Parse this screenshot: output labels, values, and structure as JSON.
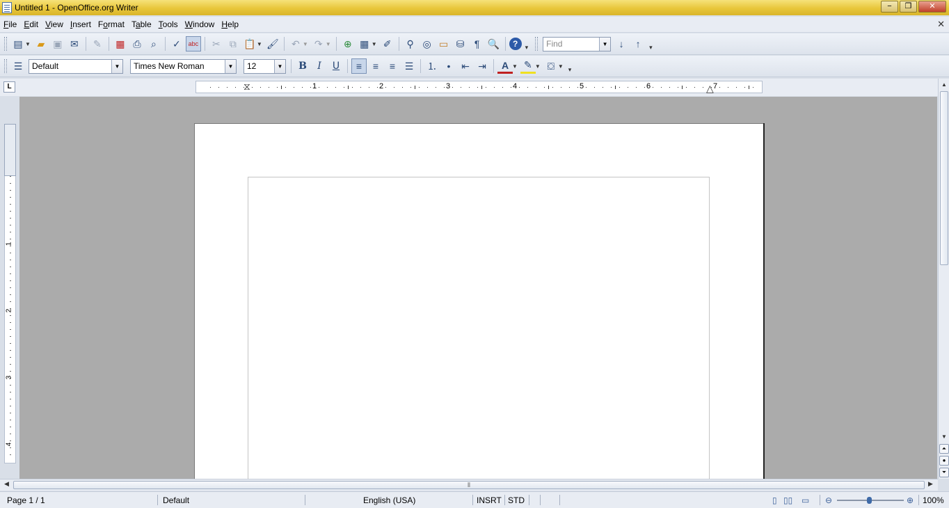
{
  "window": {
    "title": "Untitled 1 - OpenOffice.org Writer",
    "minimize_symbol": "−",
    "restore_symbol": "❐",
    "close_symbol": "✕"
  },
  "menubar": {
    "items": [
      {
        "accel": "F",
        "rest": "ile"
      },
      {
        "accel": "E",
        "rest": "dit"
      },
      {
        "accel": "V",
        "rest": "iew"
      },
      {
        "accel": "I",
        "rest": "nsert"
      },
      {
        "pre": "F",
        "accel": "o",
        "rest": "rmat"
      },
      {
        "pre": "T",
        "accel": "a",
        "rest": "ble"
      },
      {
        "accel": "T",
        "rest": "ools"
      },
      {
        "accel": "W",
        "rest": "indow"
      },
      {
        "accel": "H",
        "rest": "elp"
      }
    ],
    "doc_close_symbol": "✕"
  },
  "standard_toolbar": {
    "find_placeholder": "Find"
  },
  "formatting_toolbar": {
    "paragraph_style": "Default",
    "font_name": "Times New Roman",
    "font_size": "12",
    "bold_label": "B",
    "italic_label": "I",
    "underline_label": "U"
  },
  "ruler": {
    "tab_selector": "L",
    "numbers": [
      "1",
      "2",
      "3",
      "4",
      "5",
      "6",
      "7"
    ],
    "vertical_numbers": [
      "1",
      "2",
      "3",
      "4"
    ]
  },
  "statusbar": {
    "page": "Page 1 / 1",
    "page_style": "Default",
    "language": "English (USA)",
    "insert_mode": "INSRT",
    "selection_mode": "STD",
    "zoom": "100%"
  },
  "colors": {
    "titlebar": "#e8c63a",
    "workspace": "#ababab",
    "accent": "#3e6aa8"
  }
}
